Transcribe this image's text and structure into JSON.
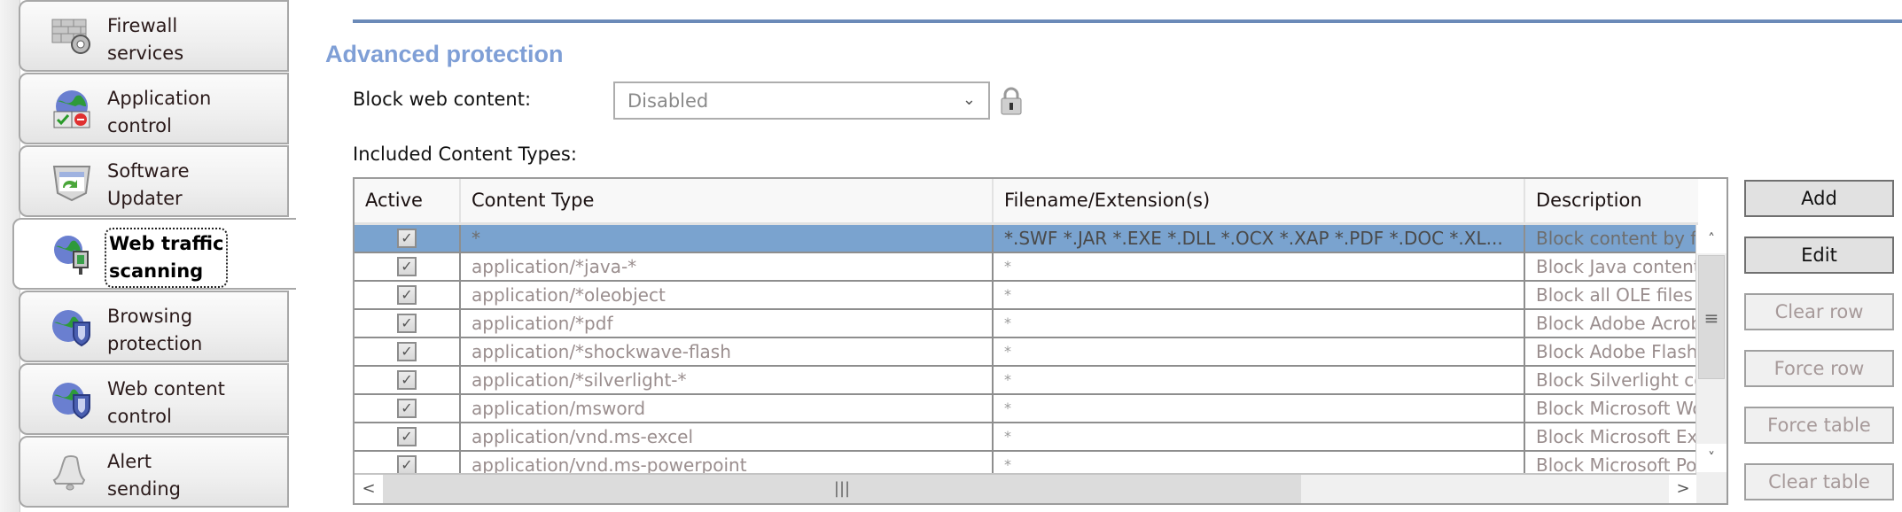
{
  "sidebar": {
    "items": [
      {
        "label": "Firewall\nservices",
        "icon": "firewall-gear-icon",
        "active": false
      },
      {
        "label": "Application\ncontrol",
        "icon": "globe-allow-deny-icon",
        "active": false
      },
      {
        "label": "Software\nUpdater",
        "icon": "software-updater-shield-icon",
        "active": false
      },
      {
        "label": "Web traffic\nscanning",
        "icon": "globe-scanner-icon",
        "active": true
      },
      {
        "label": "Browsing\nprotection",
        "icon": "globe-shield-icon",
        "active": false
      },
      {
        "label": "Web content\ncontrol",
        "icon": "globe-shield-icon",
        "active": false
      },
      {
        "label": "Alert\nsending",
        "icon": "bell-icon",
        "active": false
      }
    ]
  },
  "section": {
    "title": "Advanced protection",
    "block_web_content_label": "Block web content:",
    "block_web_content_value": "Disabled",
    "included_label": "Included Content Types:"
  },
  "table": {
    "columns": [
      "Active",
      "Content Type",
      "Filename/Extension(s)",
      "Description"
    ],
    "rows": [
      {
        "active": true,
        "content_type": "*",
        "extensions": "*.SWF *.JAR *.EXE *.DLL *.OCX *.XAP *.PDF *.DOC *.XL...",
        "description": "Block content by file extension",
        "selected": true
      },
      {
        "active": true,
        "content_type": "application/*java-*",
        "extensions": "*",
        "description": "Block Java content"
      },
      {
        "active": true,
        "content_type": "application/*oleobject",
        "extensions": "*",
        "description": "Block all OLE files"
      },
      {
        "active": true,
        "content_type": "application/*pdf",
        "extensions": "*",
        "description": "Block Adobe Acrobat"
      },
      {
        "active": true,
        "content_type": "application/*shockwave-flash",
        "extensions": "*",
        "description": "Block Adobe Flash"
      },
      {
        "active": true,
        "content_type": "application/*silverlight-*",
        "extensions": "*",
        "description": "Block Silverlight content"
      },
      {
        "active": true,
        "content_type": "application/msword",
        "extensions": "*",
        "description": "Block Microsoft Word"
      },
      {
        "active": true,
        "content_type": "application/vnd.ms-excel",
        "extensions": "*",
        "description": "Block Microsoft Excel"
      },
      {
        "active": true,
        "content_type": "application/vnd.ms-powerpoint",
        "extensions": "*",
        "description": "Block Microsoft PowerPoint"
      }
    ]
  },
  "buttons": {
    "add": "Add",
    "edit": "Edit",
    "clear_row": "Clear row",
    "force_row": "Force row",
    "force_table": "Force table",
    "clear_table": "Clear table"
  },
  "glyphs": {
    "check": "✓",
    "chevron_down": "⌄",
    "scroll_up": "˄",
    "scroll_down": "˅",
    "scroll_left": "<",
    "scroll_right": ">",
    "grip_v": "≡",
    "grip_h": "|||"
  },
  "colors": {
    "accent_rule": "#6b8ab8",
    "title": "#7f9fd6",
    "selected_row": "#7aa3cf"
  }
}
